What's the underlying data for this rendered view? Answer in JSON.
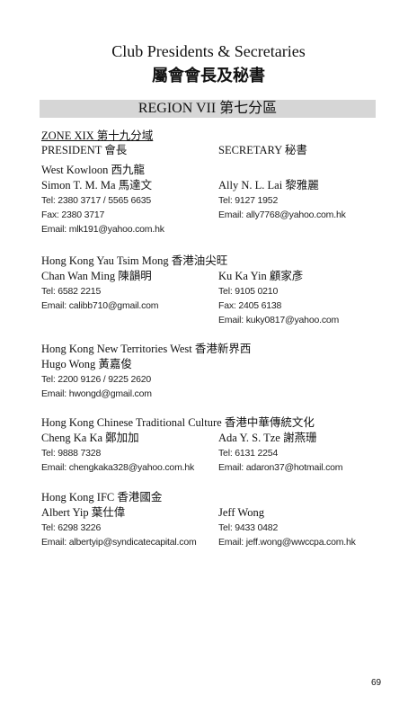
{
  "title_en": "Club Presidents & Secretaries",
  "title_zh": "屬會會長及秘書",
  "region": "REGION VII  第七分區",
  "zone": "ZONE XIX  第十九分域",
  "col_president": "PRESIDENT  會長",
  "col_secretary": "SECRETARY  秘書",
  "clubs": [
    {
      "name": "West Kowloon  西九龍",
      "president": {
        "name": "Simon T. M. Ma  馬達文",
        "lines": [
          "Tel: 2380 3717 / 5565 6635",
          "Fax: 2380 3717",
          "Email: mlk191@yahoo.com.hk"
        ]
      },
      "secretary": {
        "name": "Ally N. L. Lai  黎雅麗",
        "lines": [
          "Tel: 9127 1952",
          "Email: ally7768@yahoo.com.hk",
          ""
        ]
      }
    },
    {
      "name": "Hong Kong Yau Tsim Mong  香港油尖旺",
      "president": {
        "name": "Chan Wan Ming  陳韻明",
        "lines": [
          "Tel: 6582 2215",
          "Email: calibb710@gmail.com",
          ""
        ]
      },
      "secretary": {
        "name": "Ku Ka Yin  顧家彥",
        "lines": [
          "Tel: 9105 0210",
          "Fax: 2405 6138",
          "Email: kuky0817@yahoo.com"
        ]
      }
    },
    {
      "name": "Hong Kong New Territories West  香港新界西",
      "president": {
        "name": "Hugo Wong  黃嘉俊",
        "lines": [
          "Tel: 2200 9126 / 9225 2620",
          "Email: hwongd@gmail.com"
        ]
      },
      "secretary": {
        "name": "",
        "lines": [
          "",
          ""
        ]
      }
    },
    {
      "name": "Hong Kong Chinese Traditional Culture  香港中華傳統文化",
      "president": {
        "name": "Cheng Ka Ka  鄭加加",
        "lines": [
          "Tel: 9888 7328",
          "Email: chengkaka328@yahoo.com.hk"
        ]
      },
      "secretary": {
        "name": "Ada Y. S. Tze  謝燕珊",
        "lines": [
          "Tel: 6131 2254",
          "Email: adaron37@hotmail.com"
        ]
      }
    },
    {
      "name": "Hong Kong IFC  香港國金",
      "president": {
        "name": "Albert Yip  葉仕偉",
        "lines": [
          "Tel: 6298 3226",
          "Email: albertyip@syndicatecapital.com"
        ]
      },
      "secretary": {
        "name": "Jeff Wong",
        "lines": [
          "Tel: 9433 0482",
          "Email: jeff.wong@wwccpa.com.hk"
        ]
      }
    }
  ],
  "page_number": "69"
}
